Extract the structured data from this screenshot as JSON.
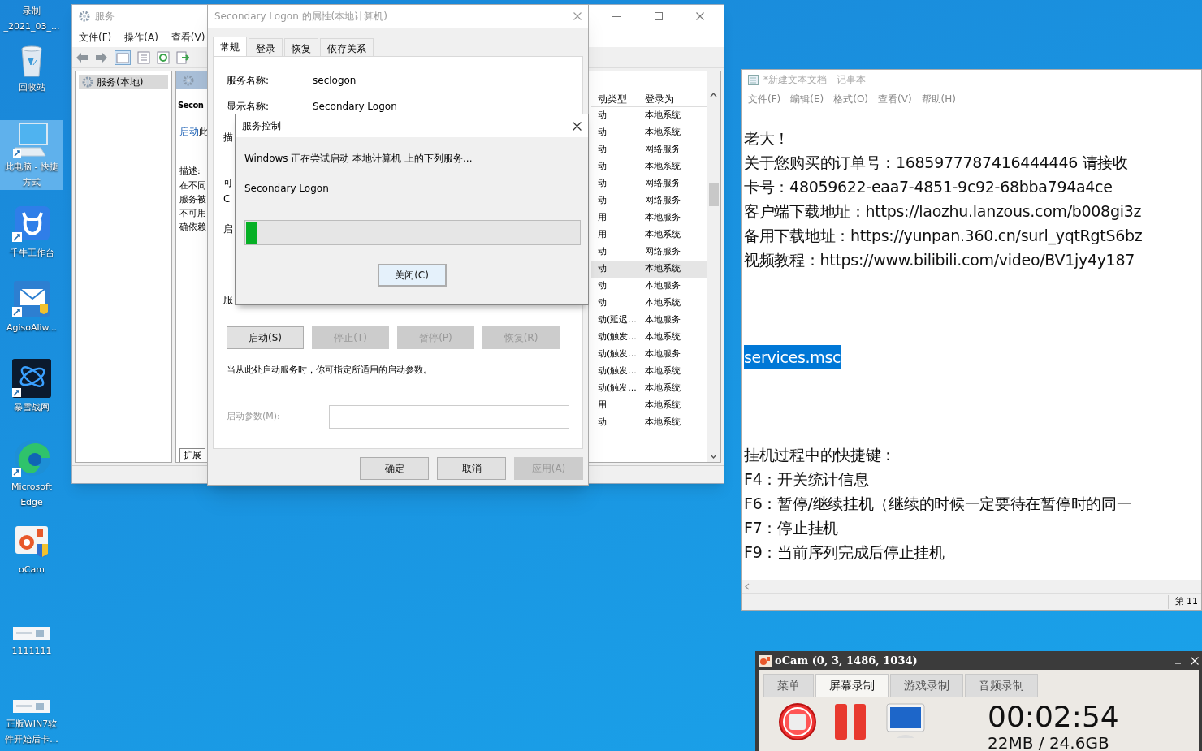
{
  "desktop_icons": [
    {
      "kind": "video",
      "lines": [
        "录制",
        "_2021_03_..."
      ],
      "selected": false
    },
    {
      "kind": "recycle",
      "lines": [
        "回收站"
      ],
      "selected": false
    },
    {
      "kind": "computer",
      "lines": [
        "此电脑 - 快捷",
        "方式"
      ],
      "selected": true
    },
    {
      "kind": "qianniu",
      "lines": [
        "千牛工作台"
      ],
      "selected": false
    },
    {
      "kind": "mail",
      "lines": [
        "AgisoAliw..."
      ],
      "selected": false
    },
    {
      "kind": "battlenet",
      "lines": [
        "暴雪战网"
      ],
      "selected": false
    },
    {
      "kind": "edge",
      "lines": [
        "Microsoft",
        "Edge"
      ],
      "selected": false
    },
    {
      "kind": "ocam",
      "lines": [
        "oCam"
      ],
      "selected": false
    },
    {
      "kind": "strip",
      "lines": [
        "1111111"
      ],
      "selected": false
    },
    {
      "kind": "strip",
      "lines": [
        "正版WIN7软",
        "件开始后卡..."
      ],
      "selected": false
    }
  ],
  "services_window": {
    "title": "服务",
    "menu": [
      "文件(F)",
      "操作(A)",
      "查看(V)"
    ],
    "tree": [
      {
        "label": "服务(本地)",
        "selected": true
      }
    ],
    "detail": {
      "name": "Secon",
      "link": "启动",
      "link_rest": "此",
      "description_label": "描述:",
      "description_lines": [
        "在不同",
        "服务被",
        "不可用",
        "确依赖"
      ],
      "tab": "扩展"
    },
    "columns": [
      "动类型",
      "登录为"
    ],
    "rows": [
      {
        "start": "动",
        "logon": "本地系统",
        "selected": false
      },
      {
        "start": "动",
        "logon": "本地系统",
        "selected": false
      },
      {
        "start": "动",
        "logon": "网络服务",
        "selected": false
      },
      {
        "start": "动",
        "logon": "本地系统",
        "selected": false
      },
      {
        "start": "动",
        "logon": "网络服务",
        "selected": false
      },
      {
        "start": "动",
        "logon": "网络服务",
        "selected": false
      },
      {
        "start": "用",
        "logon": "本地服务",
        "selected": false
      },
      {
        "start": "用",
        "logon": "本地系统",
        "selected": false
      },
      {
        "start": "动",
        "logon": "网络服务",
        "selected": false
      },
      {
        "start": "动",
        "logon": "本地系统",
        "selected": true
      },
      {
        "start": "动",
        "logon": "本地服务",
        "selected": false
      },
      {
        "start": "动",
        "logon": "本地系统",
        "selected": false
      },
      {
        "start": "动(延迟...",
        "logon": "本地服务",
        "selected": false
      },
      {
        "start": "动(触发...",
        "logon": "本地系统",
        "selected": false
      },
      {
        "start": "动(触发...",
        "logon": "本地服务",
        "selected": false
      },
      {
        "start": "动(触发...",
        "logon": "本地系统",
        "selected": false
      },
      {
        "start": "动(触发...",
        "logon": "本地系统",
        "selected": false
      },
      {
        "start": "用",
        "logon": "本地系统",
        "selected": false
      },
      {
        "start": "动",
        "logon": "本地系统",
        "selected": false
      }
    ]
  },
  "properties_dialog": {
    "title": "Secondary Logon 的属性(本地计算机)",
    "tabs": [
      {
        "label": "常规",
        "selected": true
      },
      {
        "label": "登录",
        "selected": false
      },
      {
        "label": "恢复",
        "selected": false
      },
      {
        "label": "依存关系",
        "selected": false
      }
    ],
    "fields": [
      {
        "label": "服务名称:",
        "value": "seclogon"
      },
      {
        "label": "显示名称:",
        "value": "Secondary Logon"
      }
    ],
    "partial_labels": [
      "描",
      "可",
      "C",
      "启",
      "服"
    ],
    "control_buttons": [
      {
        "label": "启动(S)",
        "disabled": false
      },
      {
        "label": "停止(T)",
        "disabled": true
      },
      {
        "label": "暂停(P)",
        "disabled": true
      },
      {
        "label": "恢复(R)",
        "disabled": true
      }
    ],
    "note": "当从此处启动服务时，你可指定所适用的启动参数。",
    "param_label": "启动参数(M):",
    "footer_buttons": [
      {
        "label": "确定",
        "disabled": false
      },
      {
        "label": "取消",
        "disabled": false
      },
      {
        "label": "应用(A)",
        "disabled": true
      }
    ]
  },
  "service_control_dialog": {
    "title": "服务控制",
    "message": "Windows 正在尝试启动 本地计算机 上的下列服务...",
    "service": "Secondary Logon",
    "progress": {
      "level": 0.035
    },
    "button": "关闭(C)"
  },
  "notepad": {
    "title": "*新建文本文档 - 记事本",
    "menu": [
      "文件(F)",
      "编辑(E)",
      "格式(O)",
      "查看(V)",
      "帮助(H)"
    ],
    "paragraphs": [
      {
        "lines": [
          {
            "text": "老大！",
            "selected": false
          },
          {
            "text": "关于您购买的订单号：1685977787416444446 请接收",
            "selected": false
          },
          {
            "text": "卡号：48059622-eaa7-4851-9c92-68bba794a4ce",
            "selected": false
          },
          {
            "text": "客户端下载地址：https://laozhu.lanzous.com/b008gi3z",
            "selected": false
          },
          {
            "text": "备用下载地址：https://yunpan.360.cn/surl_yqtRgtS6bz",
            "selected": false
          },
          {
            "text": "视频教程：https://www.bilibili.com/video/BV1jy4y187",
            "selected": false
          }
        ]
      },
      {
        "lines": [
          {
            "text": "services.msc",
            "selected": true
          }
        ]
      },
      {
        "lines": [
          {
            "text": "挂机过程中的快捷键：",
            "selected": false
          },
          {
            "text": "F4：开关统计信息",
            "selected": false
          },
          {
            "text": "F6：暂停/继续挂机（继续的时候一定要待在暂停时的同一",
            "selected": false
          },
          {
            "text": "F7：停止挂机",
            "selected": false
          },
          {
            "text": "F9：当前序列完成后停止挂机",
            "selected": false
          }
        ]
      }
    ],
    "status": "第 11"
  },
  "ocam": {
    "title": "oCam (0, 3, 1486, 1034)",
    "tabs": [
      {
        "label": "菜单",
        "selected": false
      },
      {
        "label": "屏幕录制",
        "selected": true
      },
      {
        "label": "游戏录制",
        "selected": false
      },
      {
        "label": "音频录制",
        "selected": false
      }
    ],
    "time": "00:02:54",
    "size": "22MB / 24.6GB"
  }
}
